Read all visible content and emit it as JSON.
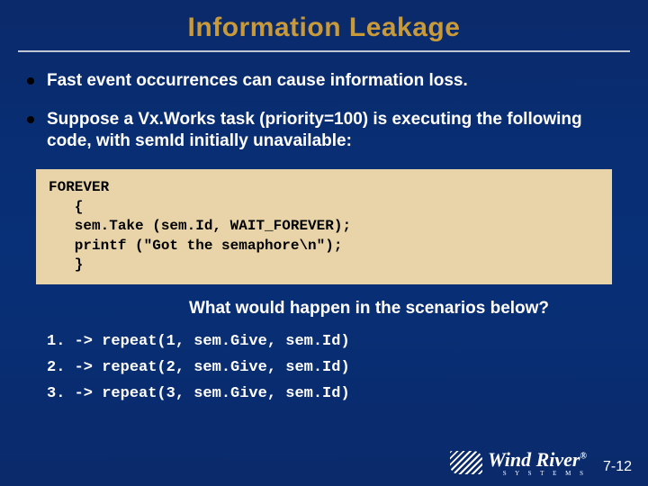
{
  "title": "Information Leakage",
  "bullets": [
    "Fast event occurrences can cause information loss.",
    "Suppose a Vx.Works task (priority=100) is executing the following code, with semId initially unavailable:"
  ],
  "code": "FOREVER\n   {\n   sem.Take (sem.Id, WAIT_FOREVER);\n   printf (\"Got the semaphore\\n\");\n   }",
  "question": "What would happen in the scenarios below?",
  "scenarios": "1. -> repeat(1, sem.Give, sem.Id)\n2. -> repeat(2, sem.Give, sem.Id)\n3. -> repeat(3, sem.Give, sem.Id)",
  "logo": {
    "text": "Wind River",
    "reg": "®",
    "sub": "S Y S T E M S"
  },
  "page": "7-12"
}
